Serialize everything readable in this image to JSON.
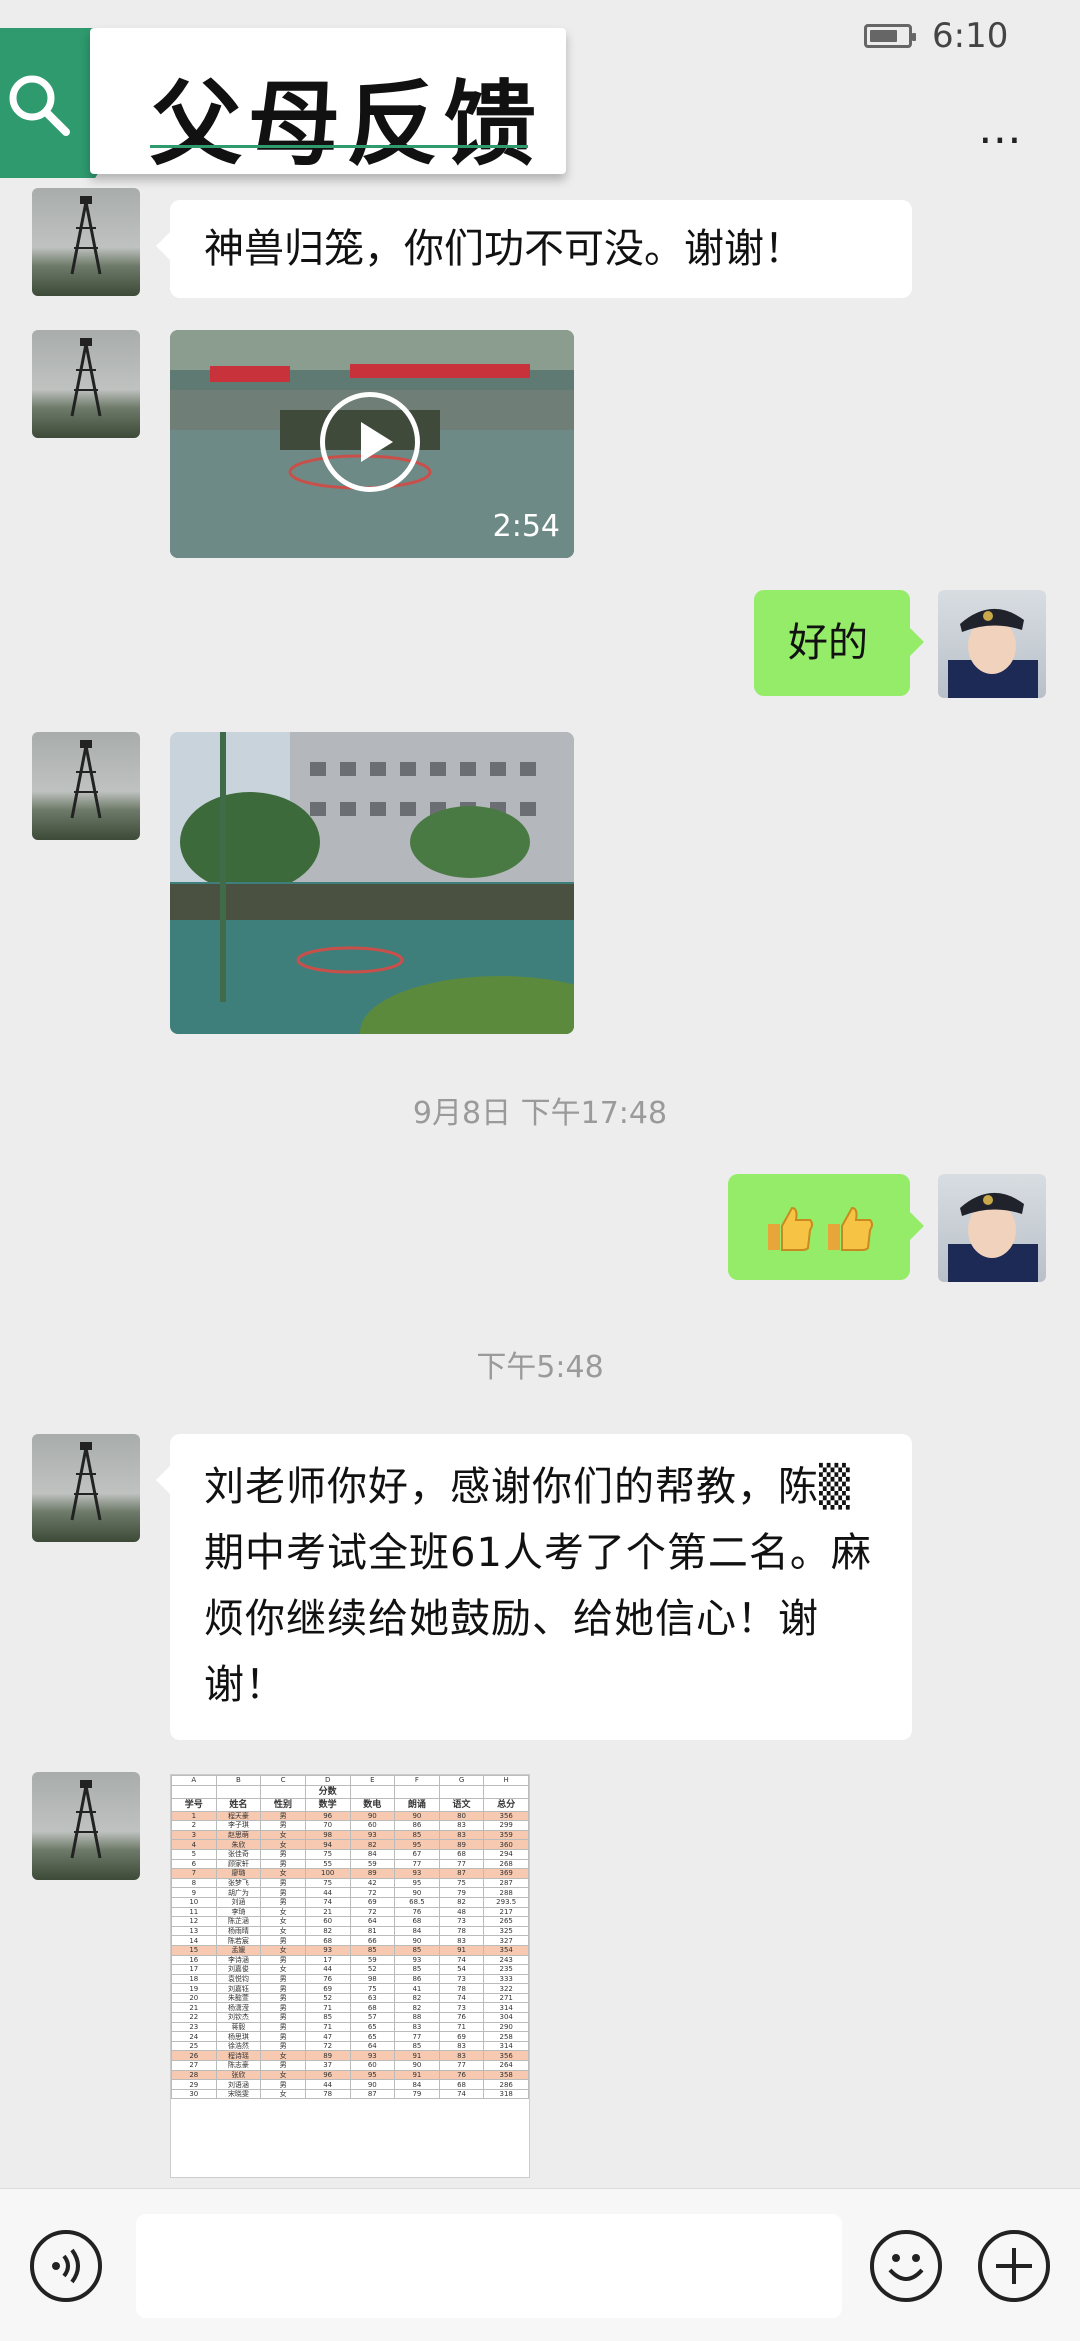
{
  "status_bar": {
    "time": "6:10",
    "battery_level": 0.75
  },
  "header": {
    "title": "父母反馈",
    "more_label": "⋯"
  },
  "messages": {
    "m1_text": "神兽归笼，你们功不可没。谢谢！",
    "video_duration": "2:54",
    "reply1": "好的",
    "ts1": "9月8日 下午17:48",
    "reply2": "👍👍",
    "ts2": "下午5:48",
    "long_text": "刘老师你好，感谢你们的帮教，陈▒期中考试全班61人考了个第二名。麻烦你继续给她鼓励、给她信心！谢谢！"
  },
  "spreadsheet": {
    "col_letters": [
      "A",
      "B",
      "C",
      "D",
      "E",
      "F",
      "G",
      "H"
    ],
    "group_header": "分数",
    "headers": [
      "学号",
      "姓名",
      "性别",
      "数学",
      "数电",
      "朗诵",
      "语文",
      "总分"
    ],
    "rows": [
      [
        "1",
        "程天豪",
        "男",
        "96",
        "90",
        "90",
        "80",
        "356"
      ],
      [
        "2",
        "李子琪",
        "男",
        "70",
        "60",
        "86",
        "83",
        "299"
      ],
      [
        "3",
        "赵思萌",
        "女",
        "98",
        "93",
        "85",
        "83",
        "359"
      ],
      [
        "4",
        "朱欣",
        "女",
        "94",
        "82",
        "95",
        "89",
        "360"
      ],
      [
        "5",
        "张佳奇",
        "男",
        "75",
        "84",
        "67",
        "68",
        "294"
      ],
      [
        "6",
        "顾家轩",
        "男",
        "55",
        "59",
        "77",
        "77",
        "268"
      ],
      [
        "7",
        "廖璐",
        "女",
        "100",
        "89",
        "93",
        "87",
        "369"
      ],
      [
        "8",
        "张梦飞",
        "男",
        "75",
        "42",
        "95",
        "75",
        "287"
      ],
      [
        "9",
        "胡广为",
        "男",
        "44",
        "72",
        "90",
        "79",
        "288"
      ],
      [
        "10",
        "刘涵",
        "男",
        "74",
        "69",
        "68.5",
        "82",
        "293.5"
      ],
      [
        "11",
        "李琦",
        "女",
        "21",
        "72",
        "76",
        "48",
        "217"
      ],
      [
        "12",
        "陈芷涵",
        "女",
        "60",
        "64",
        "68",
        "73",
        "265"
      ],
      [
        "13",
        "杨雨晴",
        "女",
        "82",
        "81",
        "84",
        "78",
        "325"
      ],
      [
        "14",
        "陈若宸",
        "男",
        "68",
        "66",
        "90",
        "83",
        "327"
      ],
      [
        "15",
        "孟媛",
        "女",
        "93",
        "85",
        "85",
        "91",
        "354"
      ],
      [
        "16",
        "李诗涵",
        "男",
        "17",
        "59",
        "93",
        "74",
        "243"
      ],
      [
        "17",
        "刘嘉俊",
        "女",
        "44",
        "52",
        "85",
        "54",
        "235"
      ],
      [
        "18",
        "袁悦钧",
        "男",
        "76",
        "98",
        "86",
        "73",
        "333"
      ],
      [
        "19",
        "刘嘉钰",
        "男",
        "69",
        "75",
        "41",
        "78",
        "322"
      ],
      [
        "20",
        "朱懿萱",
        "男",
        "52",
        "63",
        "82",
        "74",
        "271"
      ],
      [
        "21",
        "杨潇滢",
        "男",
        "71",
        "68",
        "82",
        "73",
        "314"
      ],
      [
        "22",
        "刘钦杰",
        "男",
        "85",
        "57",
        "88",
        "76",
        "304"
      ],
      [
        "23",
        "蒋毅",
        "男",
        "71",
        "65",
        "83",
        "71",
        "290"
      ],
      [
        "24",
        "杨思琪",
        "男",
        "47",
        "65",
        "77",
        "69",
        "258"
      ],
      [
        "25",
        "徐浩然",
        "男",
        "72",
        "64",
        "85",
        "83",
        "314"
      ],
      [
        "26",
        "程诗瑶",
        "女",
        "89",
        "93",
        "91",
        "83",
        "356"
      ],
      [
        "27",
        "陈志豪",
        "男",
        "37",
        "60",
        "90",
        "77",
        "264"
      ],
      [
        "28",
        "张欣",
        "女",
        "96",
        "95",
        "91",
        "76",
        "358"
      ],
      [
        "29",
        "刘语涵",
        "男",
        "44",
        "90",
        "84",
        "68",
        "286"
      ],
      [
        "30",
        "宋晓雯",
        "女",
        "78",
        "87",
        "79",
        "74",
        "318"
      ]
    ],
    "highlight_rows": [
      0,
      2,
      3,
      6,
      14,
      25,
      27
    ]
  },
  "input_bar": {
    "voice_icon": "voice-icon",
    "emoji_icon": "emoji-icon",
    "plus_icon": "plus-icon"
  }
}
